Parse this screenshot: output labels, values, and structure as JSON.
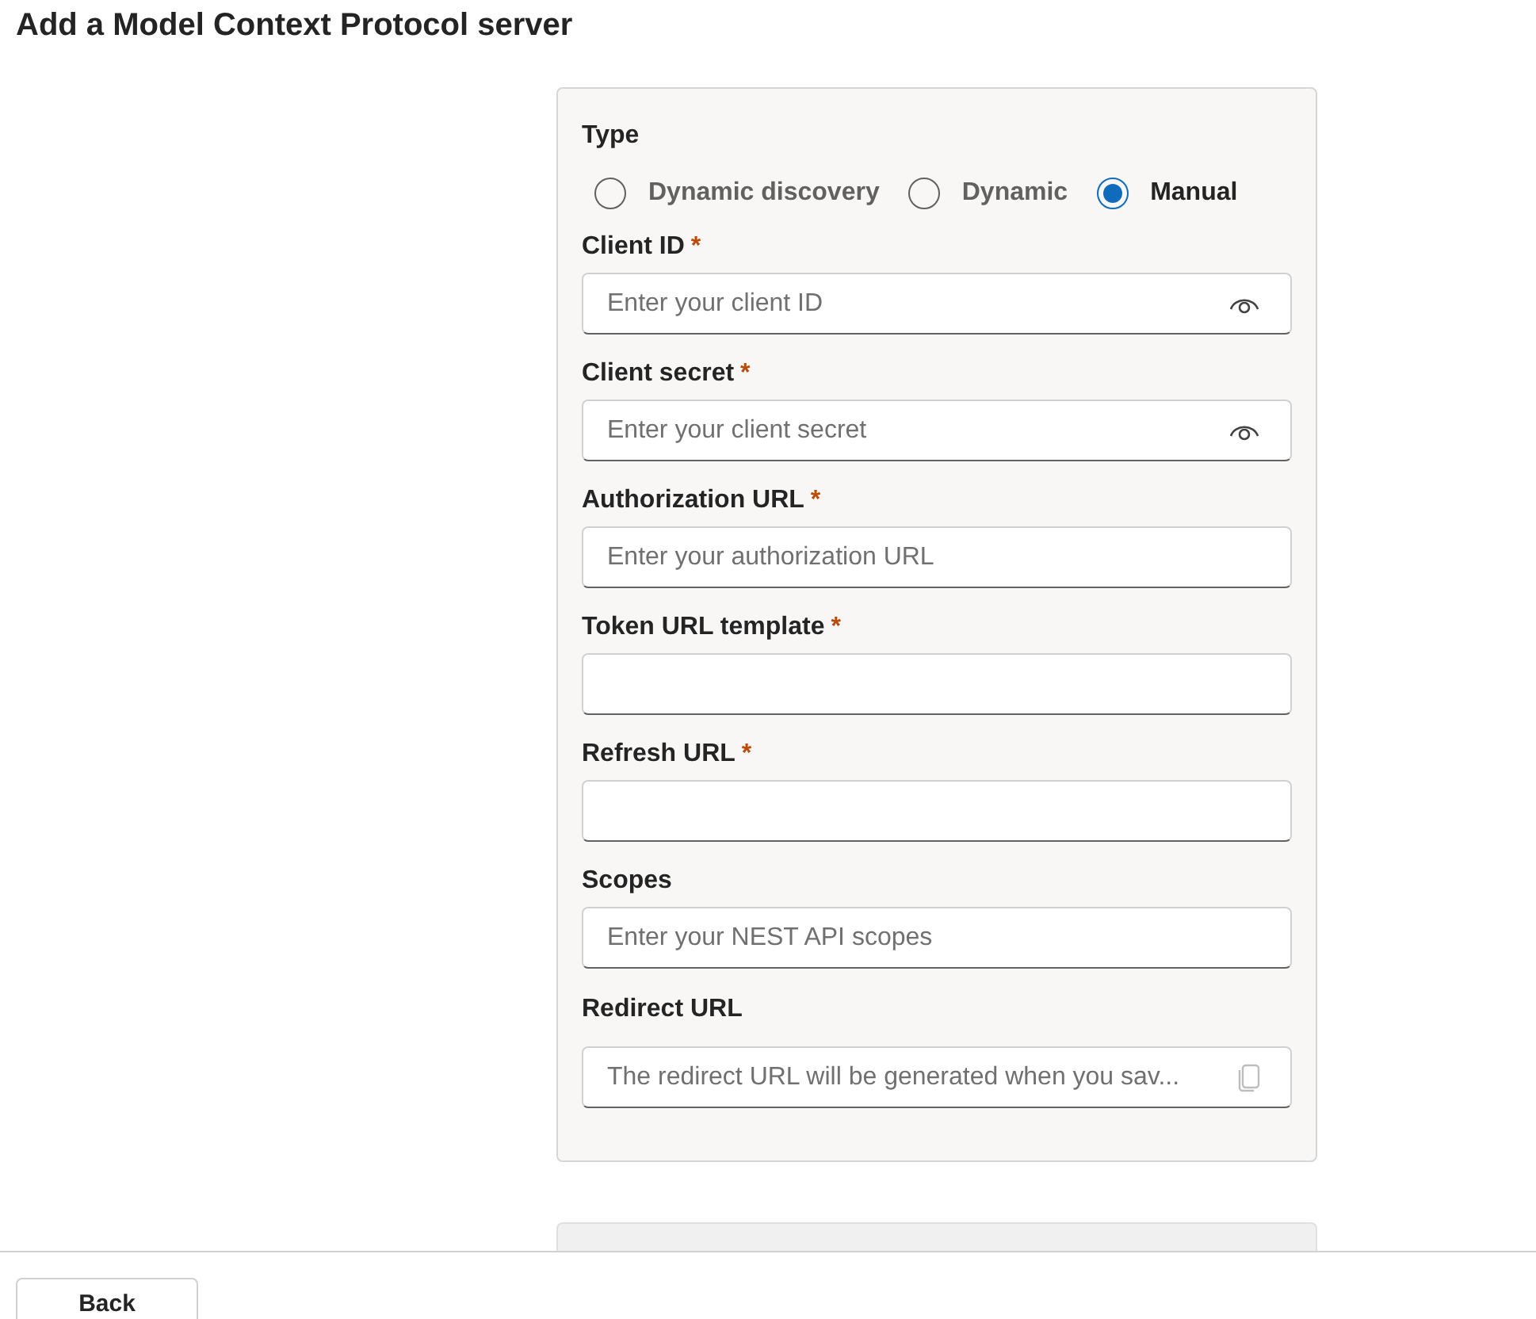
{
  "title": "Add a Model Context Protocol server",
  "type": {
    "label": "Type",
    "options": [
      {
        "label": "Dynamic discovery",
        "selected": false
      },
      {
        "label": "Dynamic",
        "selected": false
      },
      {
        "label": "Manual",
        "selected": true
      }
    ]
  },
  "fields": [
    {
      "label": "Client ID",
      "required_mark": "*",
      "placeholder": "Enter your client ID",
      "kind": "secret"
    },
    {
      "label": "Client secret",
      "required_mark": "*",
      "placeholder": "Enter your client secret",
      "kind": "secret"
    },
    {
      "label": "Authorization URL",
      "required_mark": "*",
      "placeholder": "Enter your authorization URL",
      "kind": "text"
    },
    {
      "label": "Token URL template",
      "required_mark": "*",
      "kind": "text"
    },
    {
      "label": "Refresh URL",
      "required_mark": "*",
      "kind": "text"
    },
    {
      "label": "Scopes",
      "placeholder": "Enter your NEST API scopes",
      "kind": "text"
    },
    {
      "label": "Redirect URL",
      "placeholder": "The redirect URL will be generated when you sav...",
      "kind": "copy"
    }
  ],
  "partial_button": {
    "disabled": true
  },
  "back_button": {
    "label": "Back"
  }
}
